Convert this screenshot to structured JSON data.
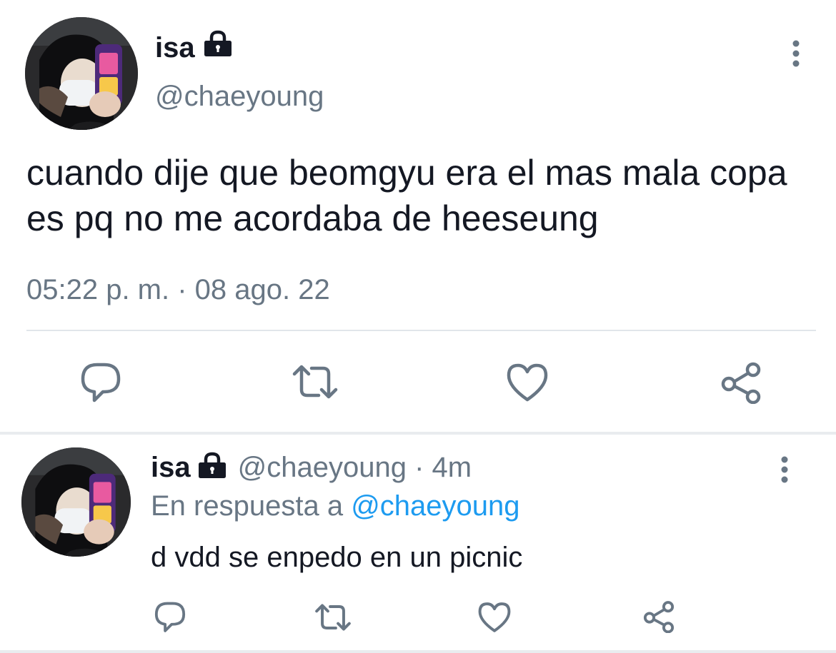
{
  "main_tweet": {
    "display_name": "isa",
    "handle": "@chaeyoung",
    "text": "cuando dije que beomgyu era el mas mala copa es pq no me acordaba de heeseung",
    "timestamp": "05:22 p. m. · 08 ago. 22",
    "icons": [
      "lock-icon",
      "more-vertical-icon",
      "reply-icon",
      "retweet-icon",
      "like-icon",
      "share-icon"
    ]
  },
  "reply_tweet": {
    "display_name": "isa",
    "handle": "@chaeyoung",
    "age": "· 4m",
    "reply_prefix": "En respuesta a",
    "reply_mention": "@chaeyoung",
    "text": "d vdd se enpedo en un picnic"
  },
  "colors": {
    "text": "#141823",
    "secondary": "#687684",
    "mention": "#1d9bf0",
    "divider": "#e1e6ea"
  }
}
